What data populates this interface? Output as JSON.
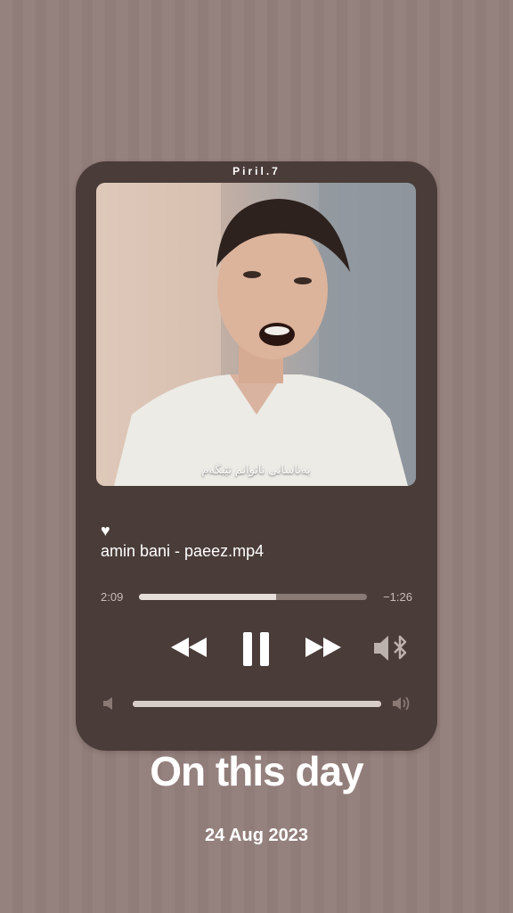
{
  "player": {
    "username": "Piril.7",
    "subtitle": "بەناسانی ناتوانم تێبگەم",
    "heart_icon": "heart-icon",
    "track_title": "amin bani - paeez.mp4",
    "time_elapsed": "2:09",
    "time_remaining": "−1:26",
    "progress_fraction": 0.6,
    "controls": {
      "rewind_icon": "rewind-icon",
      "pause_icon": "pause-icon",
      "forward_icon": "fast-forward-icon",
      "output_icon": "speaker-bluetooth-icon"
    },
    "volume_fraction": 1.0,
    "volume_low_icon": "volume-low-icon",
    "volume_high_icon": "volume-high-icon"
  },
  "memory": {
    "heading": "On this day",
    "date": "24 Aug 2023"
  },
  "colors": {
    "background": "#937f7b",
    "card": "#4a3c38",
    "text": "#ffffff"
  }
}
